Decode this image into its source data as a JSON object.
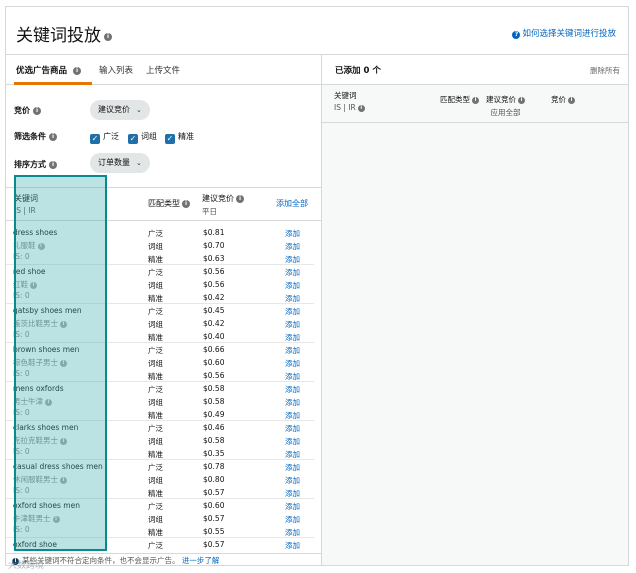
{
  "header": {
    "title": "关键词投放",
    "help_link": "如何选择关键词进行投放"
  },
  "left": {
    "tabs": [
      "优选广告商品",
      "输入列表",
      "上传文件"
    ],
    "form": {
      "bid_label": "竞价",
      "bid_value": "建议竞价",
      "filter_label": "筛选条件",
      "filters": [
        "广泛",
        "词组",
        "精准"
      ],
      "sort_label": "排序方式",
      "sort_value": "订单数量"
    },
    "list_header": {
      "keyword": "关键词",
      "keyword_sub": "IS | IR",
      "match_type": "匹配类型",
      "suggested_bid": "建议竞价",
      "suggested_bid_sub": "平日",
      "add_all": "添加全部"
    },
    "match_types": [
      "广泛",
      "词组",
      "精准"
    ],
    "add_label": "添加",
    "keywords": [
      {
        "en": "dress shoes",
        "cn": "礼服鞋",
        "is": "IS:  0",
        "bids": [
          "$0.81",
          "$0.70",
          "$0.63"
        ]
      },
      {
        "en": "red shoe",
        "cn": "红鞋",
        "is": "IS:  0",
        "bids": [
          "$0.56",
          "$0.56",
          "$0.42"
        ]
      },
      {
        "en": "gatsby shoes men",
        "cn": "盖茨比鞋男士",
        "is": "IS:  0",
        "bids": [
          "$0.45",
          "$0.42",
          "$0.40"
        ]
      },
      {
        "en": "brown shoes men",
        "cn": "棕色鞋子男士",
        "is": "IS:  0",
        "bids": [
          "$0.66",
          "$0.60",
          "$0.56"
        ]
      },
      {
        "en": "mens oxfords",
        "cn": "男士牛津",
        "is": "IS:  0",
        "bids": [
          "$0.58",
          "$0.58",
          "$0.49"
        ]
      },
      {
        "en": "clarks shoes men",
        "cn": "克拉克鞋男士",
        "is": "IS:  0",
        "bids": [
          "$0.46",
          "$0.58",
          "$0.35"
        ]
      },
      {
        "en": "casual dress shoes men",
        "cn": "休闲服鞋男士",
        "is": "IS:  0",
        "bids": [
          "$0.78",
          "$0.80",
          "$0.57"
        ]
      },
      {
        "en": "oxford shoes men",
        "cn": "牛津鞋男士",
        "is": "IS:  0",
        "bids": [
          "$0.60",
          "$0.57",
          "$0.55"
        ]
      },
      {
        "en": "oxford shoe",
        "cn": "",
        "is": "",
        "bids": [
          "$0.57"
        ]
      }
    ],
    "bottom_note": "某些关键词不符合定向条件，也不会显示广告。",
    "bottom_link": "进一步了解"
  },
  "right": {
    "title": "已添加 0 个",
    "remove_all": "删除所有",
    "col_keyword": "关键词",
    "col_keyword_sub": "IS | IR",
    "col_match": "匹配类型",
    "col_bid": "建议竞价",
    "col_bid_sub": "应用全部",
    "col_price": "竞价"
  },
  "watermark": "大数跨境",
  "colors": {
    "accent_tab": "#e77600",
    "link": "#0066c0",
    "highlight": "#0a8a8f",
    "checkbox": "#1f6fa8"
  }
}
